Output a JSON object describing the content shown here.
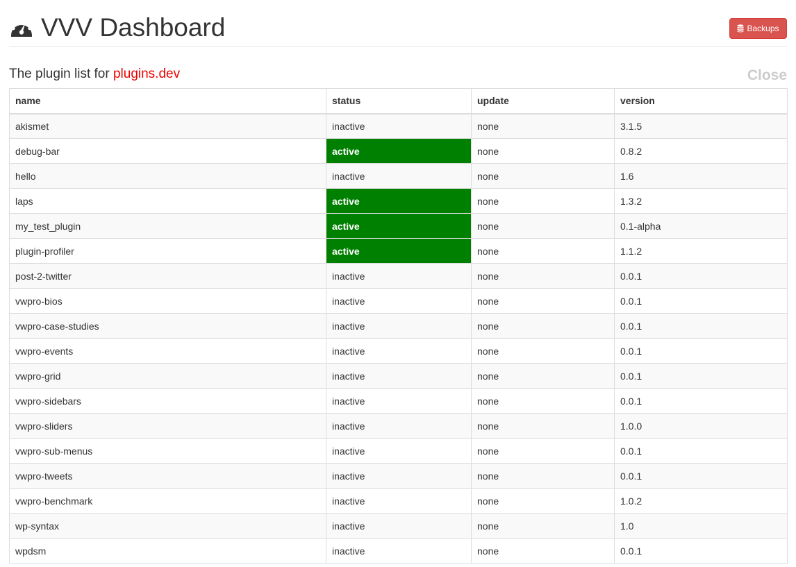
{
  "header": {
    "title": "VVV Dashboard",
    "icon": "dashboard-gauge-icon",
    "backups_label": "Backups",
    "backups_icon": "database-icon"
  },
  "subheader": {
    "prefix": "The plugin list for ",
    "site": "plugins.dev",
    "close_label": "Close"
  },
  "colors": {
    "active_status": "#008000",
    "site_link": "#ee0000",
    "backups_button": "#d9534f",
    "close_link": "#cccccc"
  },
  "table": {
    "columns": [
      "name",
      "status",
      "update",
      "version"
    ],
    "rows": [
      {
        "name": "akismet",
        "status": "inactive",
        "update": "none",
        "version": "3.1.5"
      },
      {
        "name": "debug-bar",
        "status": "active",
        "update": "none",
        "version": "0.8.2"
      },
      {
        "name": "hello",
        "status": "inactive",
        "update": "none",
        "version": "1.6"
      },
      {
        "name": "laps",
        "status": "active",
        "update": "none",
        "version": "1.3.2"
      },
      {
        "name": "my_test_plugin",
        "status": "active",
        "update": "none",
        "version": "0.1-alpha"
      },
      {
        "name": "plugin-profiler",
        "status": "active",
        "update": "none",
        "version": "1.1.2"
      },
      {
        "name": "post-2-twitter",
        "status": "inactive",
        "update": "none",
        "version": "0.0.1"
      },
      {
        "name": "vwpro-bios",
        "status": "inactive",
        "update": "none",
        "version": "0.0.1"
      },
      {
        "name": "vwpro-case-studies",
        "status": "inactive",
        "update": "none",
        "version": "0.0.1"
      },
      {
        "name": "vwpro-events",
        "status": "inactive",
        "update": "none",
        "version": "0.0.1"
      },
      {
        "name": "vwpro-grid",
        "status": "inactive",
        "update": "none",
        "version": "0.0.1"
      },
      {
        "name": "vwpro-sidebars",
        "status": "inactive",
        "update": "none",
        "version": "0.0.1"
      },
      {
        "name": "vwpro-sliders",
        "status": "inactive",
        "update": "none",
        "version": "1.0.0"
      },
      {
        "name": "vwpro-sub-menus",
        "status": "inactive",
        "update": "none",
        "version": "0.0.1"
      },
      {
        "name": "vwpro-tweets",
        "status": "inactive",
        "update": "none",
        "version": "0.0.1"
      },
      {
        "name": "vwpro-benchmark",
        "status": "inactive",
        "update": "none",
        "version": "1.0.2"
      },
      {
        "name": "wp-syntax",
        "status": "inactive",
        "update": "none",
        "version": "1.0"
      },
      {
        "name": "wpdsm",
        "status": "inactive",
        "update": "none",
        "version": "0.0.1"
      }
    ]
  }
}
